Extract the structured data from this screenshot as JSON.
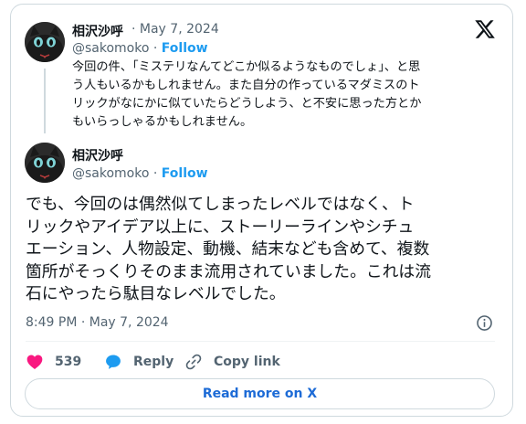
{
  "quoted_tweet": {
    "author_name": "相沢沙呼",
    "date": "· May 7, 2024",
    "handle": "@sakomoko",
    "separator": "·",
    "follow_label": "Follow",
    "text": "今回の件、「ミステリなんてどこか似るようなものでしょ」、と思\nう人もいるかもしれません。また自分の作っているマダミスのト\nリックがなにかに似ていたらどうしよう、と不安に思った方とか\nもいらっしゃるかもしれません。"
  },
  "main_tweet": {
    "author_name": "相沢沙呼",
    "handle": "@sakomoko",
    "separator": "·",
    "follow_label": "Follow",
    "text": "でも、今回のは偶然似てしまったレベルではなく、ト\nリックやアイデア以上に、ストーリーラインやシチュ\nエーション、人物設定、動機、結末なども含めて、複数\n箇所がそっくりそのまま流用されていました。これは流\n石にやったら駄目なレベルでした。",
    "timestamp": "8:49 PM · May 7, 2024"
  },
  "actions": {
    "like_count": "539",
    "reply_label": "Reply",
    "copy_link_label": "Copy link"
  },
  "read_more_label": "Read more on X",
  "icons": {
    "logo": "x-logo-icon",
    "like": "heart-icon",
    "reply": "speech-bubble-icon",
    "copy_link": "link-icon",
    "info": "info-icon"
  },
  "colors": {
    "accent": "#1d9bf0",
    "like": "#f91880",
    "reply": "#1d9bf0",
    "text_secondary": "#536471",
    "read_more": "#1d6bd6"
  }
}
